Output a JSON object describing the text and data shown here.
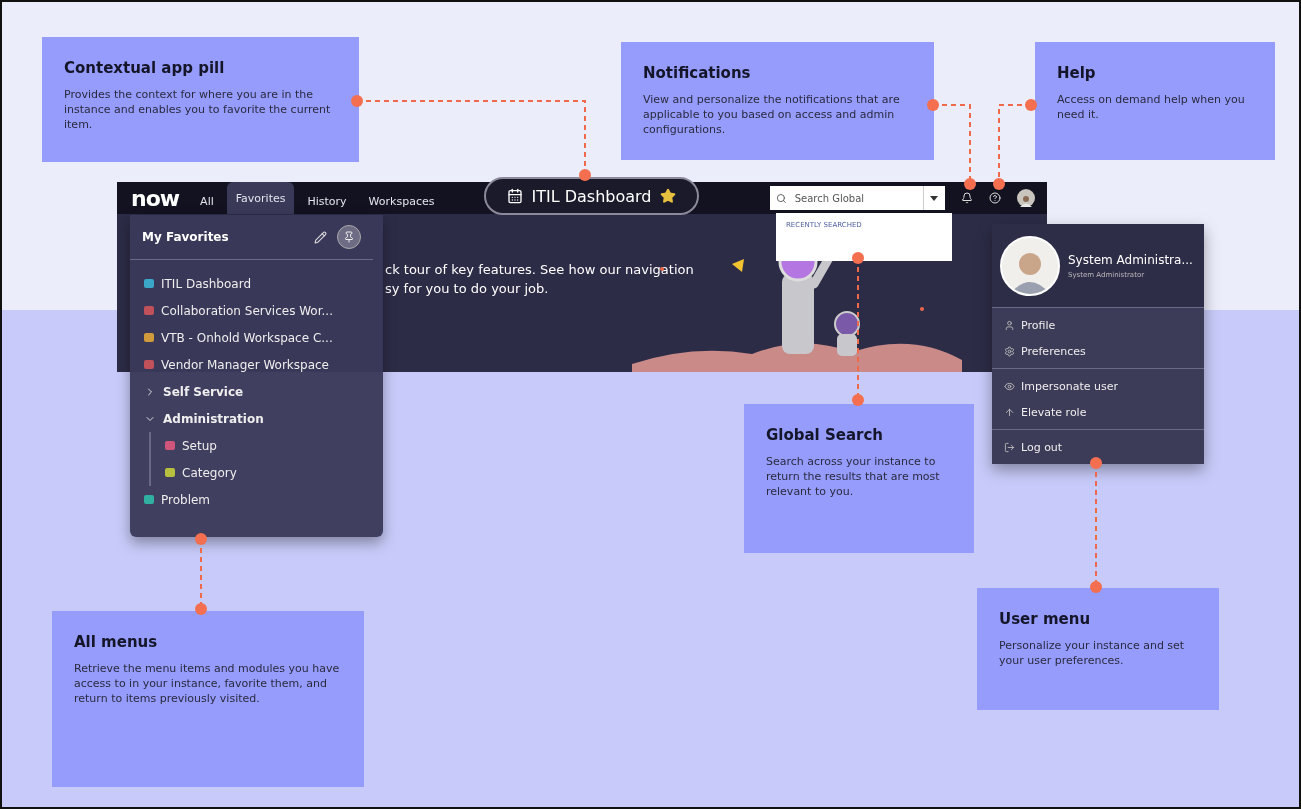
{
  "callouts": [
    {
      "title": "Contextual app pill",
      "text": "Provides the context for where you are in the instance and enables you to favorite the current item."
    },
    {
      "title": "Notifications",
      "text": "View and personalize the notifications that are applicable to you based on access and admin configurations."
    },
    {
      "title": "Help",
      "text": "Access on demand help when you need it."
    },
    {
      "title": "Global Search",
      "text": "Search across your instance to return the results that are most relevant to you."
    },
    {
      "title": "All menus",
      "text": "Retrieve the menu items and modules you have access to in your instance, favorite them, and return to items previously visited."
    },
    {
      "title": "User menu",
      "text": "Personalize your instance and set your user preferences."
    }
  ],
  "nav": {
    "logo": "now",
    "tabs": [
      {
        "label": "All",
        "selected": false
      },
      {
        "label": "Favorites",
        "selected": true
      },
      {
        "label": "History",
        "selected": false
      },
      {
        "label": "Workspaces",
        "selected": false
      }
    ],
    "app_pill": {
      "title": "ITIL Dashboard",
      "favorited": true
    },
    "search": {
      "placeholder": "Search Global",
      "dropdown_heading": "RECENTLY SEARCHED"
    }
  },
  "banner": {
    "lines": [
      "ck tour of key features. See how our navigation",
      "sy for you to do your job."
    ]
  },
  "favorites_menu": {
    "title": "My Favorites",
    "items": [
      {
        "label": "ITIL Dashboard",
        "kind": "module",
        "color": "#3aa6c8"
      },
      {
        "label": "Collaboration Services Wor...",
        "kind": "module",
        "color": "#c0505a"
      },
      {
        "label": "VTB - Onhold Workspace C...",
        "kind": "module",
        "color": "#d19a3a"
      },
      {
        "label": "Vendor Manager Workspace",
        "kind": "module",
        "color": "#c0505a"
      },
      {
        "label": "Self Service",
        "kind": "group",
        "expanded": false
      },
      {
        "label": "Administration",
        "kind": "group",
        "expanded": true,
        "children": [
          {
            "label": "Setup",
            "kind": "module",
            "color": "#d0557a"
          },
          {
            "label": "Category",
            "kind": "module",
            "color": "#b8c040"
          }
        ]
      },
      {
        "label": "Problem",
        "kind": "module",
        "color": "#2fb0a0"
      }
    ]
  },
  "user_menu": {
    "name": "System Administra...",
    "role": "System Administrator",
    "sections": [
      {
        "items": [
          {
            "label": "Profile"
          },
          {
            "label": "Preferences"
          }
        ]
      },
      {
        "items": [
          {
            "label": "Impersonate user"
          },
          {
            "label": "Elevate role"
          }
        ]
      },
      {
        "items": [
          {
            "label": "Log out"
          }
        ]
      }
    ]
  }
}
